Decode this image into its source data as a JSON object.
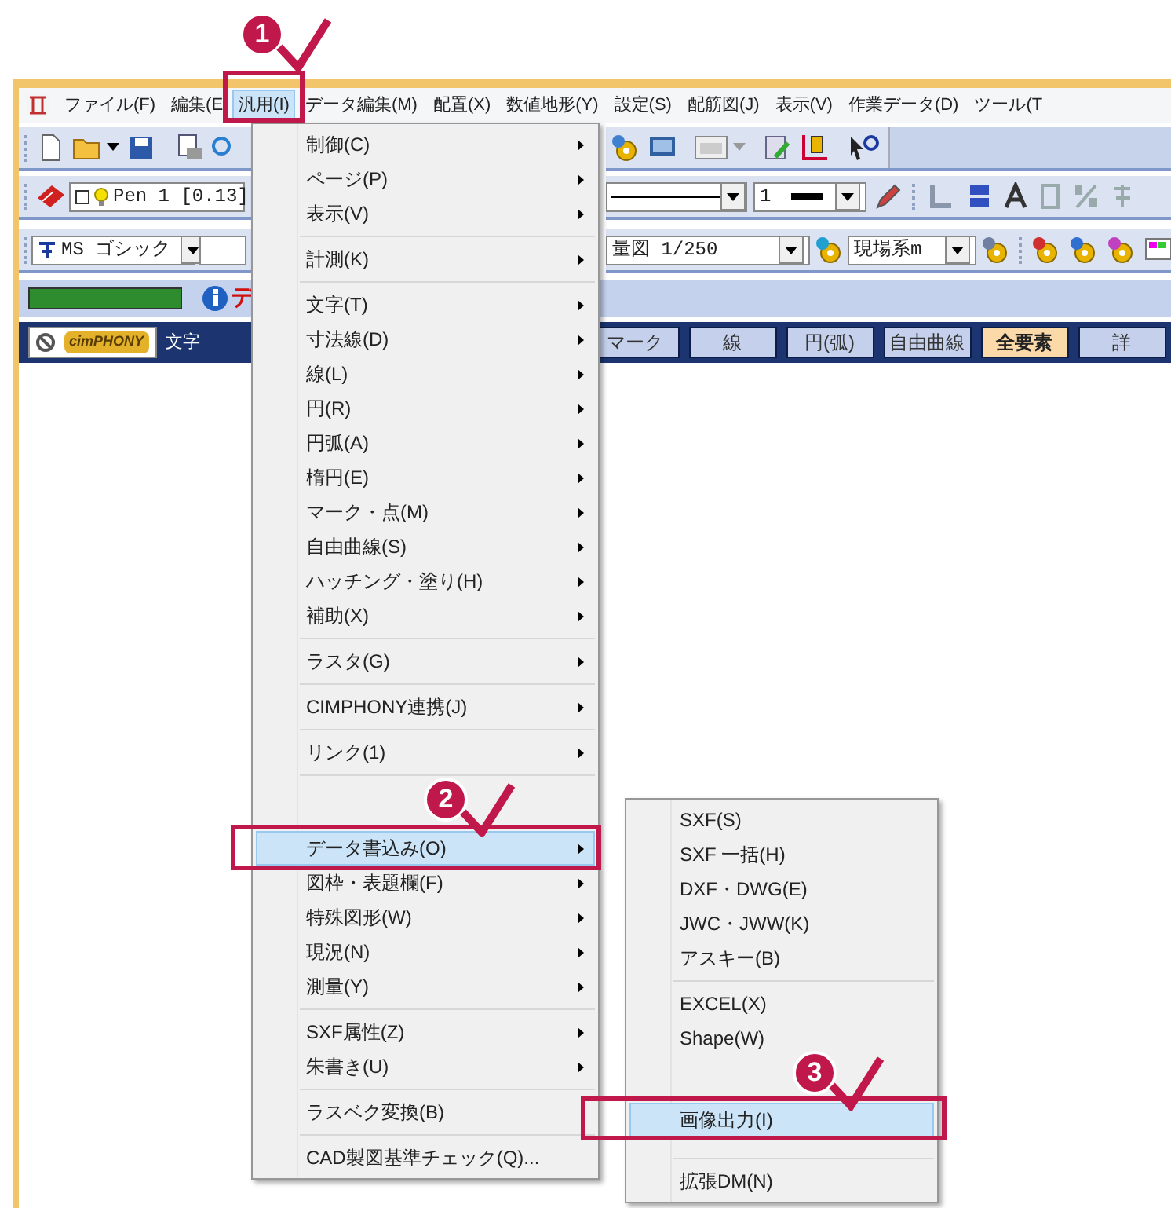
{
  "menubar": [
    {
      "label": "ファイル(F)",
      "selected": false
    },
    {
      "label": "編集(E",
      "selected": false
    },
    {
      "label": "汎用(I)",
      "selected": true
    },
    {
      "label": "データ編集(M)",
      "selected": false
    },
    {
      "label": "配置(X)",
      "selected": false
    },
    {
      "label": "数値地形(Y)",
      "selected": false
    },
    {
      "label": "設定(S)",
      "selected": false
    },
    {
      "label": "配筋図(J)",
      "selected": false
    },
    {
      "label": "表示(V)",
      "selected": false
    },
    {
      "label": "作業データ(D)",
      "selected": false
    },
    {
      "label": "ツール(T",
      "selected": false
    }
  ],
  "pen_field": {
    "value": "Pen 1  [0.13]"
  },
  "line_width_field": {
    "value": "1"
  },
  "font_field": {
    "value": "MS ゴシック"
  },
  "scale_field": {
    "value": "量図 1/250"
  },
  "unit_field": {
    "value": "現場系m"
  },
  "status": {
    "level": 1,
    "message": "デ"
  },
  "tabs_left": {
    "logo": "cimPHONY",
    "label": "文字"
  },
  "tabs": [
    {
      "label": "マーク",
      "selected": false
    },
    {
      "label": "線",
      "selected": false
    },
    {
      "label": "円(弧)",
      "selected": false
    },
    {
      "label": "自由曲線",
      "selected": false
    },
    {
      "label": "全要素",
      "selected": true
    },
    {
      "label": "詳",
      "selected": false
    }
  ],
  "main_menu": {
    "sections": [
      [
        {
          "label": "制御(C)",
          "submenu": true,
          "highlighted": false
        },
        {
          "label": "ページ(P)",
          "submenu": true,
          "highlighted": false
        },
        {
          "label": "表示(V)",
          "submenu": true,
          "highlighted": false
        }
      ],
      [
        {
          "label": "計測(K)",
          "submenu": true,
          "highlighted": false
        }
      ],
      [
        {
          "label": "文字(T)",
          "submenu": true,
          "highlighted": false
        },
        {
          "label": "寸法線(D)",
          "submenu": true,
          "highlighted": false
        },
        {
          "label": "線(L)",
          "submenu": true,
          "highlighted": false
        },
        {
          "label": "円(R)",
          "submenu": true,
          "highlighted": false
        },
        {
          "label": "円弧(A)",
          "submenu": true,
          "highlighted": false
        },
        {
          "label": "楕円(E)",
          "submenu": true,
          "highlighted": false
        },
        {
          "label": "マーク・点(M)",
          "submenu": true,
          "highlighted": false
        },
        {
          "label": "自由曲線(S)",
          "submenu": true,
          "highlighted": false
        },
        {
          "label": "ハッチング・塗り(H)",
          "submenu": true,
          "highlighted": false
        },
        {
          "label": "補助(X)",
          "submenu": true,
          "highlighted": false
        }
      ],
      [
        {
          "label": "ラスタ(G)",
          "submenu": true,
          "highlighted": false
        }
      ],
      [
        {
          "label": "CIMPHONY連携(J)",
          "submenu": true,
          "highlighted": false
        }
      ],
      [
        {
          "label": "リンク(1)",
          "submenu": true,
          "highlighted": false
        }
      ],
      [
        {
          "label": "データ書込み(O)",
          "submenu": true,
          "highlighted": true
        },
        {
          "label": "図枠・表題欄(F)",
          "submenu": true,
          "highlighted": false
        },
        {
          "label": "特殊図形(W)",
          "submenu": true,
          "highlighted": false
        },
        {
          "label": "現況(N)",
          "submenu": true,
          "highlighted": false
        },
        {
          "label": "測量(Y)",
          "submenu": true,
          "highlighted": false
        }
      ],
      [
        {
          "label": "SXF属性(Z)",
          "submenu": true,
          "highlighted": false
        },
        {
          "label": "朱書き(U)",
          "submenu": true,
          "highlighted": false
        }
      ],
      [
        {
          "label": "ラスベク変換(B)",
          "submenu": false,
          "highlighted": false
        }
      ],
      [
        {
          "label": "CAD製図基準チェック(Q)...",
          "submenu": false,
          "highlighted": false
        }
      ]
    ]
  },
  "submenu": {
    "sections": [
      [
        {
          "label": "SXF(S)",
          "highlighted": false
        },
        {
          "label": "SXF 一括(H)",
          "highlighted": false
        },
        {
          "label": "DXF・DWG(E)",
          "highlighted": false
        },
        {
          "label": "JWC・JWW(K)",
          "highlighted": false
        },
        {
          "label": "アスキー(B)",
          "highlighted": false
        }
      ],
      [
        {
          "label": "EXCEL(X)",
          "highlighted": false
        },
        {
          "label": "Shape(W)",
          "highlighted": false
        },
        {
          "label": "画像出力(I)",
          "highlighted": true
        }
      ],
      [
        {
          "label": "拡張DM(N)",
          "highlighted": false
        }
      ]
    ]
  },
  "steps": [
    {
      "number": "1"
    },
    {
      "number": "2"
    },
    {
      "number": "3"
    }
  ]
}
